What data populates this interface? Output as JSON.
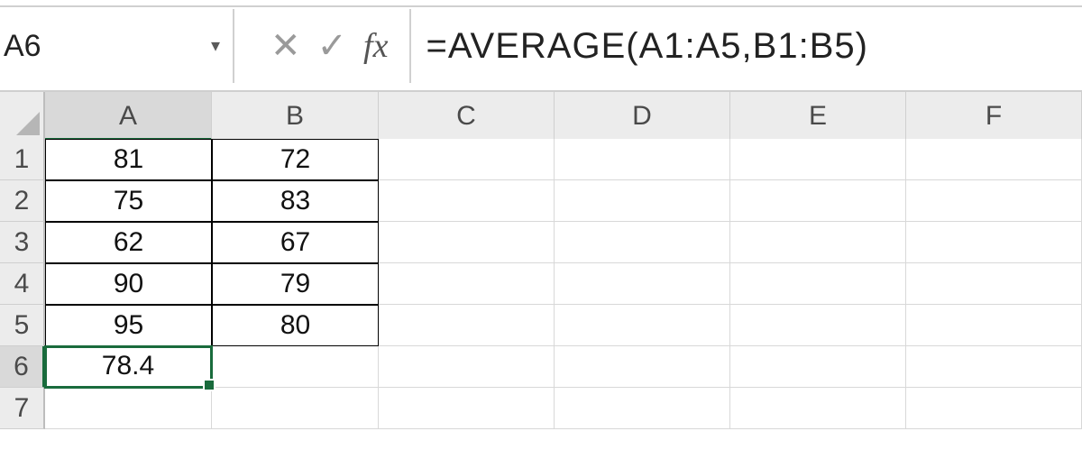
{
  "name_box": {
    "value": "A6"
  },
  "formula_bar": {
    "cancel_glyph": "✕",
    "enter_glyph": "✓",
    "fx_label": "fx",
    "formula": "=AVERAGE(A1:A5,B1:B5)"
  },
  "columns": [
    "A",
    "B",
    "C",
    "D",
    "E",
    "F"
  ],
  "rows": [
    "1",
    "2",
    "3",
    "4",
    "5",
    "6",
    "7"
  ],
  "active_cell": {
    "col": "A",
    "row": "6"
  },
  "cells": {
    "A1": "81",
    "B1": "72",
    "A2": "75",
    "B2": "83",
    "A3": "62",
    "B3": "67",
    "A4": "90",
    "B4": "79",
    "A5": "95",
    "B5": "80",
    "A6": "78.4"
  },
  "chart_data": {
    "type": "table",
    "columns": [
      "A",
      "B"
    ],
    "rows": [
      [
        81,
        72
      ],
      [
        75,
        83
      ],
      [
        62,
        67
      ],
      [
        90,
        79
      ],
      [
        95,
        80
      ]
    ],
    "summary": {
      "label": "AVERAGE(A1:A5,B1:B5)",
      "value": 78.4
    }
  }
}
